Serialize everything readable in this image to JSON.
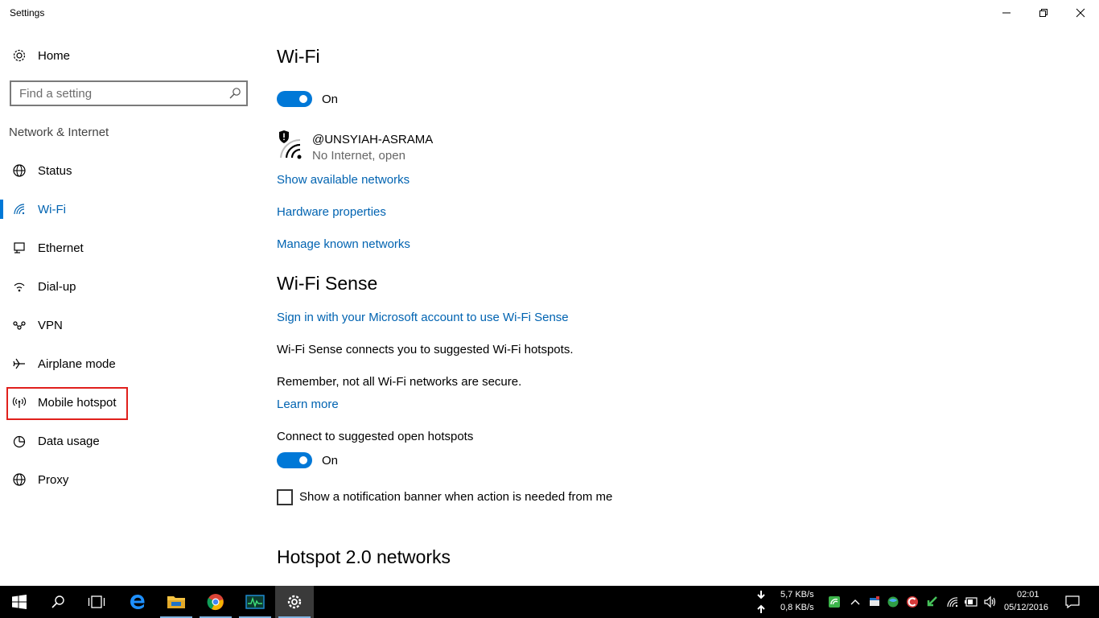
{
  "window": {
    "title": "Settings",
    "controls": {
      "minimize": "minimize",
      "restore": "restore",
      "close": "close"
    }
  },
  "sidebar": {
    "home_label": "Home",
    "search_placeholder": "Find a setting",
    "section_label": "Network & Internet",
    "items": [
      {
        "label": "Status",
        "icon": "globe-icon"
      },
      {
        "label": "Wi-Fi",
        "icon": "wifi-icon",
        "active": true
      },
      {
        "label": "Ethernet",
        "icon": "ethernet-icon"
      },
      {
        "label": "Dial-up",
        "icon": "dialup-icon"
      },
      {
        "label": "VPN",
        "icon": "vpn-icon"
      },
      {
        "label": "Airplane mode",
        "icon": "airplane-icon"
      },
      {
        "label": "Mobile hotspot",
        "icon": "hotspot-icon",
        "highlighted": true
      },
      {
        "label": "Data usage",
        "icon": "data-usage-icon"
      },
      {
        "label": "Proxy",
        "icon": "globe-icon"
      }
    ]
  },
  "main": {
    "wifi_title": "Wi-Fi",
    "wifi_toggle": "On",
    "network": {
      "name": "@UNSYIAH-ASRAMA",
      "status": "No Internet, open"
    },
    "links": {
      "show_networks": "Show available networks",
      "hardware_properties": "Hardware properties",
      "manage_known": "Manage known networks"
    },
    "wifi_sense": {
      "title": "Wi-Fi Sense",
      "sign_in_link": "Sign in with your Microsoft account to use Wi-Fi Sense",
      "description": "Wi-Fi Sense connects you to suggested Wi-Fi hotspots.",
      "warning": "Remember, not all Wi-Fi networks are secure.",
      "learn_more": "Learn more",
      "connect_label": "Connect to suggested open hotspots",
      "connect_toggle": "On",
      "notification_label": "Show a notification banner when action is needed from me"
    },
    "hotspot_title": "Hotspot 2.0 networks"
  },
  "taskbar": {
    "apps": [
      "start-icon",
      "search-icon",
      "task-view-icon",
      "edge-icon",
      "file-explorer-icon",
      "chrome-icon",
      "monitor-app-icon",
      "settings-gear-icon"
    ],
    "download_speed": "5,7 KB/s",
    "upload_speed": "0,8 KB/s",
    "time": "02:01",
    "date": "05/12/2016"
  },
  "colors": {
    "accent": "#0078d7",
    "link": "#0063b1",
    "highlight_border": "#e0201c",
    "taskbar": "#000000"
  }
}
